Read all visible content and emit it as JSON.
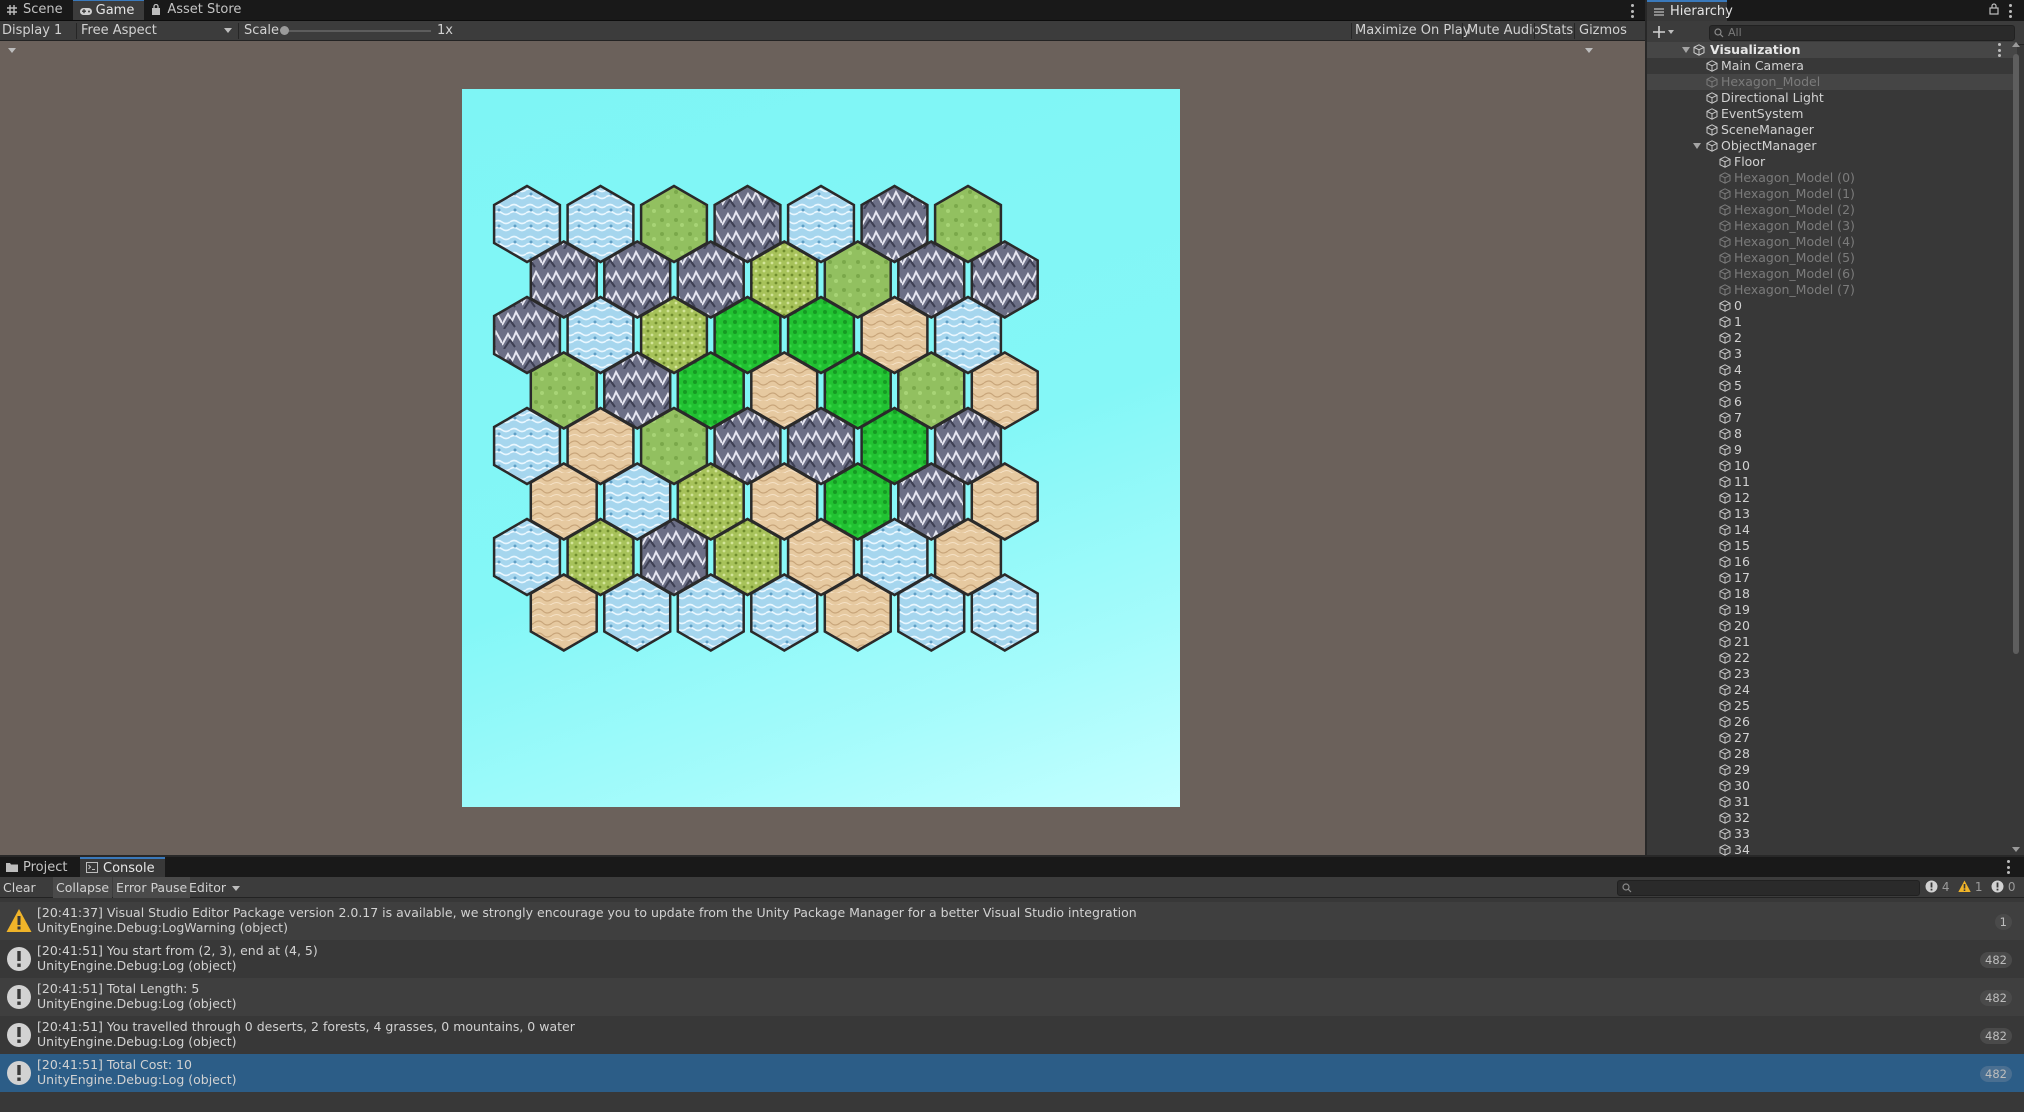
{
  "game_panel": {
    "tabs": [
      {
        "label": "Scene",
        "icon": "grid-icon"
      },
      {
        "label": "Game",
        "icon": "gamepad-icon"
      },
      {
        "label": "Asset Store",
        "icon": "bag-icon"
      }
    ],
    "toolbar": {
      "display": "Display 1",
      "aspect": "Free Aspect",
      "scale_label": "Scale",
      "scale_value": "1x",
      "scale_fraction": 0.0,
      "maximize_on_play": "Maximize On Play",
      "mute_audio": "Mute Audio",
      "stats": "Stats",
      "gizmos": "Gizmos"
    },
    "viewport": {
      "background_top": "#7ef5f5",
      "background_bottom": "#c4ffff",
      "tile_colors": {
        "W": "#a6d6ee",
        "M": "#6c6f86",
        "G": "#92c060",
        "F": "#21c232",
        "S": "#e6c9a0",
        "L": "#a7c25a"
      },
      "hex_rows": [
        [
          "W",
          "W",
          "G",
          "M",
          "W",
          "M",
          "G"
        ],
        [
          "M",
          "M",
          "M",
          "L",
          "G",
          "M",
          "M"
        ],
        [
          "M",
          "W",
          "L",
          "F",
          "F",
          "S",
          "W"
        ],
        [
          "G",
          "M",
          "F",
          "S",
          "F",
          "G",
          "S"
        ],
        [
          "W",
          "S",
          "G",
          "M",
          "M",
          "F",
          "M"
        ],
        [
          "S",
          "W",
          "L",
          "S",
          "F",
          "M",
          "S"
        ],
        [
          "W",
          "L",
          "M",
          "L",
          "S",
          "W",
          "S"
        ],
        [
          "S",
          "W",
          "W",
          "W",
          "S",
          "W",
          "W"
        ]
      ]
    }
  },
  "hierarchy": {
    "tab_label": "Hierarchy",
    "search_placeholder": "All",
    "root": "Visualization",
    "items": [
      {
        "label": "Main Camera",
        "depth": 1,
        "dim": false
      },
      {
        "label": "Hexagon_Model",
        "depth": 1,
        "dim": true,
        "selected": true
      },
      {
        "label": "Directional Light",
        "depth": 1,
        "dim": false
      },
      {
        "label": "EventSystem",
        "depth": 1,
        "dim": false
      },
      {
        "label": "SceneManager",
        "depth": 1,
        "dim": false
      },
      {
        "label": "ObjectManager",
        "depth": 1,
        "dim": false,
        "expanded": true
      },
      {
        "label": "Floor",
        "depth": 2,
        "dim": false
      },
      {
        "label": "Hexagon_Model (0)",
        "depth": 2,
        "dim": true
      },
      {
        "label": "Hexagon_Model (1)",
        "depth": 2,
        "dim": true
      },
      {
        "label": "Hexagon_Model (2)",
        "depth": 2,
        "dim": true
      },
      {
        "label": "Hexagon_Model (3)",
        "depth": 2,
        "dim": true
      },
      {
        "label": "Hexagon_Model (4)",
        "depth": 2,
        "dim": true
      },
      {
        "label": "Hexagon_Model (5)",
        "depth": 2,
        "dim": true
      },
      {
        "label": "Hexagon_Model (6)",
        "depth": 2,
        "dim": true
      },
      {
        "label": "Hexagon_Model (7)",
        "depth": 2,
        "dim": true
      },
      {
        "label": "0",
        "depth": 2
      },
      {
        "label": "1",
        "depth": 2
      },
      {
        "label": "2",
        "depth": 2
      },
      {
        "label": "3",
        "depth": 2
      },
      {
        "label": "4",
        "depth": 2
      },
      {
        "label": "5",
        "depth": 2
      },
      {
        "label": "6",
        "depth": 2
      },
      {
        "label": "7",
        "depth": 2
      },
      {
        "label": "8",
        "depth": 2
      },
      {
        "label": "9",
        "depth": 2
      },
      {
        "label": "10",
        "depth": 2
      },
      {
        "label": "11",
        "depth": 2
      },
      {
        "label": "12",
        "depth": 2
      },
      {
        "label": "13",
        "depth": 2
      },
      {
        "label": "14",
        "depth": 2
      },
      {
        "label": "15",
        "depth": 2
      },
      {
        "label": "16",
        "depth": 2
      },
      {
        "label": "17",
        "depth": 2
      },
      {
        "label": "18",
        "depth": 2
      },
      {
        "label": "19",
        "depth": 2
      },
      {
        "label": "20",
        "depth": 2
      },
      {
        "label": "21",
        "depth": 2
      },
      {
        "label": "22",
        "depth": 2
      },
      {
        "label": "23",
        "depth": 2
      },
      {
        "label": "24",
        "depth": 2
      },
      {
        "label": "25",
        "depth": 2
      },
      {
        "label": "26",
        "depth": 2
      },
      {
        "label": "27",
        "depth": 2
      },
      {
        "label": "28",
        "depth": 2
      },
      {
        "label": "29",
        "depth": 2
      },
      {
        "label": "30",
        "depth": 2
      },
      {
        "label": "31",
        "depth": 2
      },
      {
        "label": "32",
        "depth": 2
      },
      {
        "label": "33",
        "depth": 2
      },
      {
        "label": "34",
        "depth": 2
      }
    ]
  },
  "console_panel": {
    "tabs": [
      {
        "label": "Project",
        "icon": "folder-icon"
      },
      {
        "label": "Console",
        "icon": "console-icon"
      }
    ],
    "toolbar": {
      "clear": "Clear",
      "collapse": "Collapse",
      "error_pause": "Error Pause",
      "editor": "Editor"
    },
    "counts": {
      "log": "4",
      "warning": "1",
      "error": "0"
    },
    "entries": [
      {
        "type": "warning",
        "line1": "[20:41:37] Visual Studio Editor Package version 2.0.17 is available, we strongly encourage you to update from the Unity Package Manager for a better Visual Studio integration",
        "line2": "UnityEngine.Debug:LogWarning (object)",
        "count": "1"
      },
      {
        "type": "info",
        "line1": "[20:41:51] You start from (2, 3), end at (4, 5)",
        "line2": "UnityEngine.Debug:Log (object)",
        "count": "482"
      },
      {
        "type": "info",
        "line1": "[20:41:51] Total Length: 5",
        "line2": "UnityEngine.Debug:Log (object)",
        "count": "482"
      },
      {
        "type": "info",
        "line1": "[20:41:51] You travelled through 0 deserts, 2 forests, 4 grasses, 0 mountains, 0 water",
        "line2": "UnityEngine.Debug:Log (object)",
        "count": "482"
      },
      {
        "type": "info",
        "line1": "[20:41:51] Total Cost: 10",
        "line2": "UnityEngine.Debug:Log (object)",
        "count": "482",
        "selected": true
      }
    ]
  },
  "colors": {
    "accent": "#3a79bb",
    "selection": "#2c5d87",
    "warning": "#f0b429",
    "game_background": "#6b615b"
  }
}
